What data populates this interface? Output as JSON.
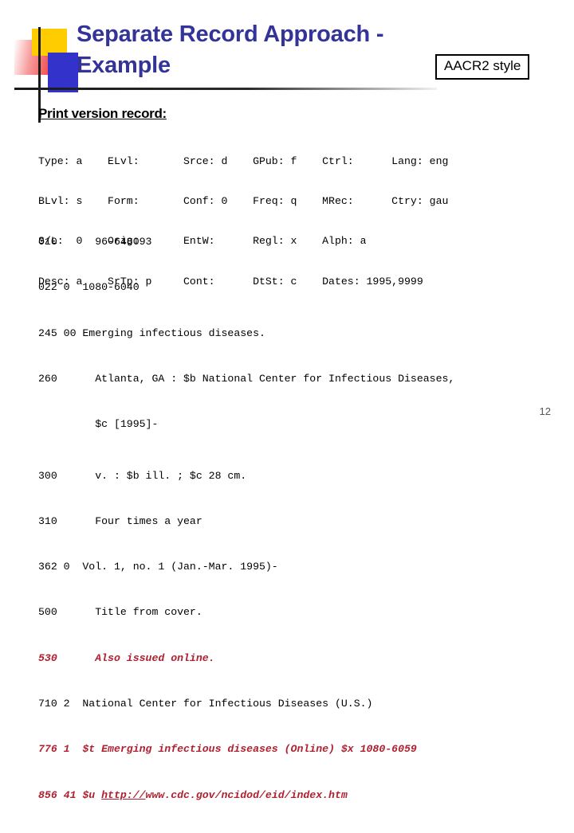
{
  "slide": {
    "title": "Separate Record Approach - Example",
    "title_line1": "Separate Record Approach -",
    "title_line2": "Example",
    "callout_label": "AACR2 style",
    "record_heading": "Print version record:",
    "slide_number": "12",
    "colors": {
      "title": "#333399",
      "body_text": "#000000",
      "online_highlight": "#b02030",
      "logo_yellow": "#ffcc00",
      "logo_blue": "#3333cc",
      "logo_pink": "#f04848"
    }
  },
  "fixed_fields": {
    "rows": [
      "Type: a    ELvl:       Srce: d    GPub: f    Ctrl:      Lang: eng",
      "BLvl: s    Form:       Conf: 0    Freq: q    MRec:      Ctry: gau",
      "S/L:  0    Orig:       EntW:      Regl: x    Alph: a",
      "Desc: a    SrTp: p     Cont:      DtSt: c    Dates: 1995,9999"
    ],
    "labels": [
      {
        "name": "Type",
        "value": "a"
      },
      {
        "name": "ELvl",
        "value": ""
      },
      {
        "name": "Srce",
        "value": "d"
      },
      {
        "name": "GPub",
        "value": "f"
      },
      {
        "name": "Ctrl",
        "value": ""
      },
      {
        "name": "Lang",
        "value": "eng"
      },
      {
        "name": "BLvl",
        "value": "s"
      },
      {
        "name": "Form",
        "value": ""
      },
      {
        "name": "Conf",
        "value": "0"
      },
      {
        "name": "Freq",
        "value": "q"
      },
      {
        "name": "MRec",
        "value": ""
      },
      {
        "name": "Ctry",
        "value": "gau"
      },
      {
        "name": "S/L",
        "value": "0"
      },
      {
        "name": "Orig",
        "value": ""
      },
      {
        "name": "EntW",
        "value": ""
      },
      {
        "name": "Regl",
        "value": "x"
      },
      {
        "name": "Alph",
        "value": "a"
      },
      {
        "name": "Desc",
        "value": "a"
      },
      {
        "name": "SrTp",
        "value": "p"
      },
      {
        "name": "Cont",
        "value": ""
      },
      {
        "name": "DtSt",
        "value": "c"
      },
      {
        "name": "Dates",
        "value": "1995,9999"
      }
    ]
  },
  "variable_fields": {
    "rows": [
      {
        "text": "010      96-648093",
        "tag": "010",
        "indicators": "",
        "style": "plain"
      },
      {
        "text": "022 0  1080-6040",
        "tag": "022",
        "indicators": "0",
        "style": "plain"
      },
      {
        "text": "245 00 Emerging infectious diseases.",
        "tag": "245",
        "indicators": "00",
        "style": "plain"
      },
      {
        "text": "260      Atlanta, GA : $b National Center for Infectious Diseases,",
        "tag": "260",
        "indicators": "",
        "style": "plain"
      },
      {
        "text": "         $c [1995]-",
        "tag": "",
        "indicators": "",
        "style": "plain"
      },
      {
        "text": "300      v. : $b ill. ; $c 28 cm.",
        "tag": "300",
        "indicators": "",
        "style": "plain"
      },
      {
        "text": "310      Four times a year",
        "tag": "310",
        "indicators": "",
        "style": "plain"
      },
      {
        "text": "362 0  Vol. 1, no. 1 (Jan.-Mar. 1995)-",
        "tag": "362",
        "indicators": "0",
        "style": "plain"
      },
      {
        "text": "500      Title from cover.",
        "tag": "500",
        "indicators": "",
        "style": "plain"
      },
      {
        "text": "530      Also issued online.",
        "tag": "530",
        "indicators": "",
        "style": "online"
      },
      {
        "text": "710 2  National Center for Infectious Diseases (U.S.)",
        "tag": "710",
        "indicators": "2",
        "style": "plain"
      },
      {
        "text": "776 1  $t Emerging infectious diseases (Online) $x 1080-6059",
        "tag": "776",
        "indicators": "1",
        "style": "online"
      },
      {
        "text": "856 41 $u http://www.cdc.gov/ncidod/eid/index.htm",
        "tag": "856",
        "indicators": "41",
        "style": "online"
      }
    ],
    "link_856": {
      "prefix": "856 41 $u ",
      "underlined": "http://",
      "rest": "www.cdc.gov/ncidod/eid/index.htm"
    }
  }
}
